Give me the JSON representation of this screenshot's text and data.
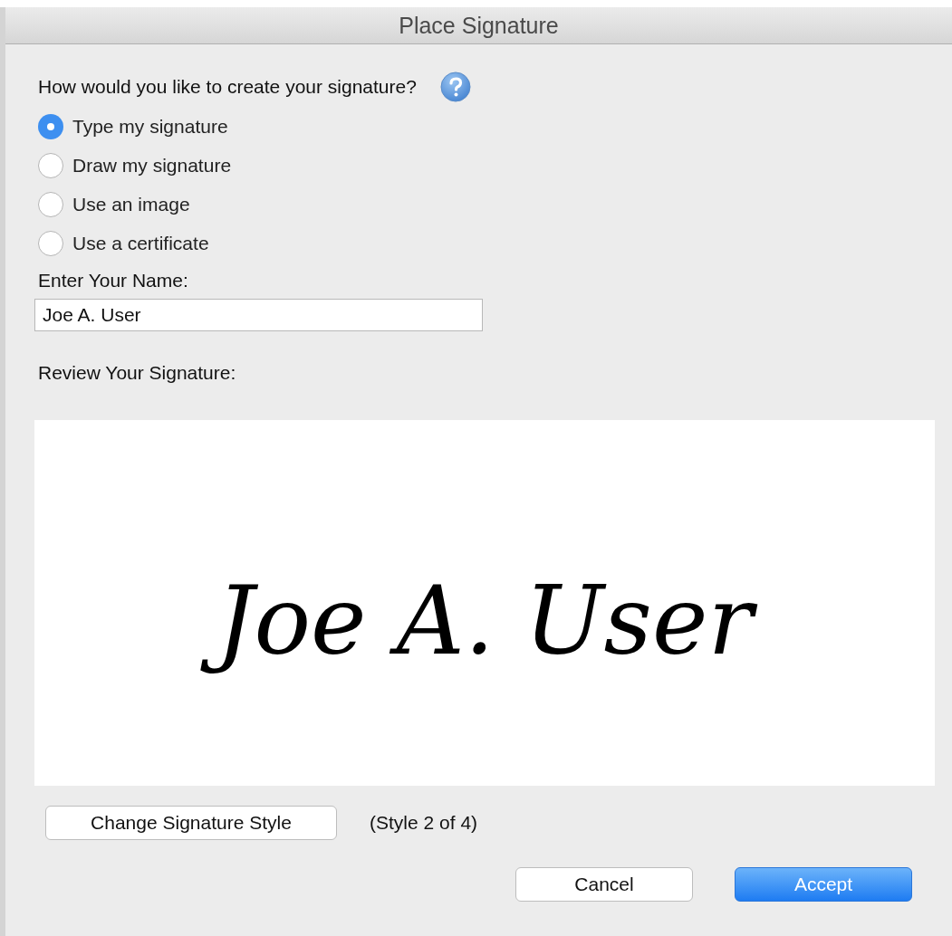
{
  "window": {
    "title": "Place Signature"
  },
  "question": "How would you like to create your signature?",
  "options": [
    {
      "label": "Type my signature",
      "selected": true
    },
    {
      "label": "Draw my signature",
      "selected": false
    },
    {
      "label": "Use an image",
      "selected": false
    },
    {
      "label": "Use a certificate",
      "selected": false
    }
  ],
  "name_field": {
    "label": "Enter Your Name:",
    "value": "Joe A. User"
  },
  "review": {
    "label": "Review Your Signature:",
    "signature": "Joe A. User"
  },
  "style_button": "Change Signature Style",
  "style_note": "(Style 2 of 4)",
  "buttons": [
    {
      "label": "Cancel",
      "kind": "normal"
    },
    {
      "label": "Accept",
      "kind": "default"
    }
  ]
}
